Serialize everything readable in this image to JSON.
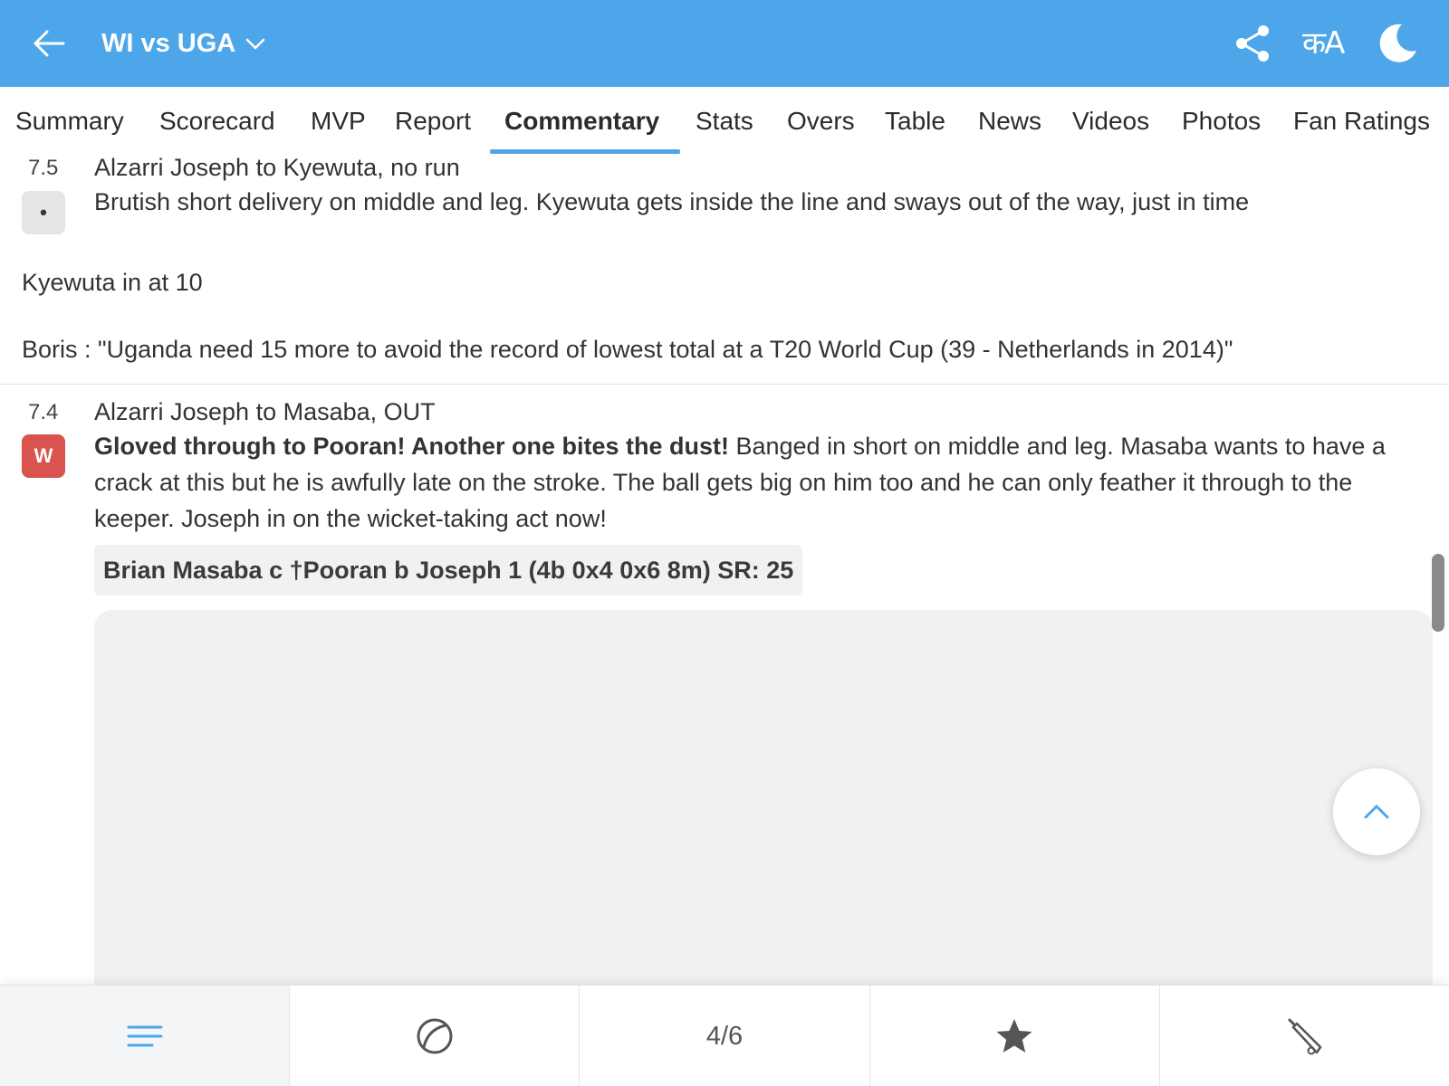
{
  "header": {
    "title": "WI vs UGA",
    "lang_label": "कA"
  },
  "tabs": [
    "Summary",
    "Scorecard",
    "MVP",
    "Report",
    "Commentary",
    "Stats",
    "Overs",
    "Table",
    "News",
    "Videos",
    "Photos",
    "Fan Ratings"
  ],
  "active_tab": "Commentary",
  "commentary": [
    {
      "over": "7.5",
      "headline": "Alzarri Joseph to Kyewuta, no run",
      "badge": "•",
      "text": "Brutish short delivery on middle and leg. Kyewuta gets inside the line and sways out of the way, just in time"
    },
    {
      "over": "7.4",
      "headline": "Alzarri Joseph to Masaba, OUT",
      "badge": "W",
      "bold_text": "Gloved through to Pooran! Another one bites the dust!",
      "text": " Banged in short on middle and leg. Masaba wants to have a crack at this but he is awfully late on the stroke. The ball gets big on him too and he can only feather it through to the keeper. Joseph in on the wicket-taking act now!",
      "dismissal": "Brian Masaba c †Pooran b Joseph 1 (4b 0x4 0x6 8m) SR: 25"
    }
  ],
  "notes": [
    "Kyewuta in at 10",
    "Boris : \"Uganda need 15 more to avoid the record of lowest total at a T20 World Cup (39 - Netherlands in 2014)\""
  ],
  "bottom_bar": {
    "page_indicator": "4/6"
  },
  "colors": {
    "header_bg": "#4da6ea",
    "accent": "#4da6ea",
    "wicket_badge": "#d9534f"
  }
}
